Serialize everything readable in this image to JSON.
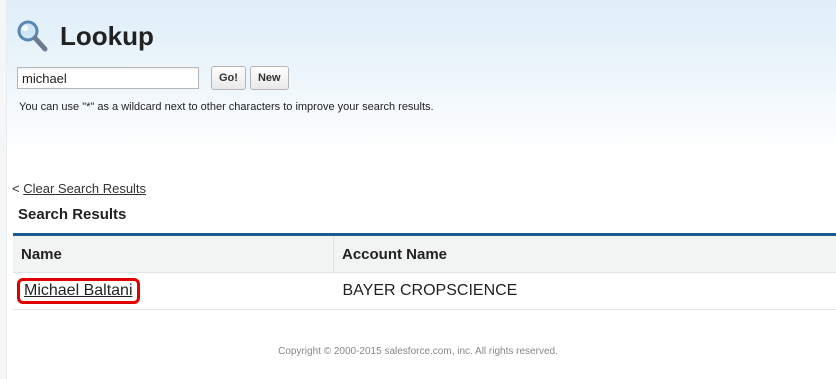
{
  "header": {
    "title": "Lookup",
    "icon": "magnifier-icon"
  },
  "search": {
    "value": "michael",
    "go_label": "Go!",
    "new_label": "New",
    "hint": "You can use \"*\" as a wildcard next to other characters to improve your search results."
  },
  "results": {
    "clear_prefix": "<",
    "clear_label": "Clear Search Results",
    "section_title": "Search Results",
    "columns": [
      "Name",
      "Account Name"
    ],
    "rows": [
      {
        "name": "Michael Baltani",
        "account": "BAYER CROPSCIENCE"
      }
    ]
  },
  "footer": {
    "copyright": "Copyright © 2000-2015 salesforce.com, inc. All rights reserved."
  },
  "colors": {
    "accent": "#1f5b91",
    "highlight": "#e00000"
  }
}
